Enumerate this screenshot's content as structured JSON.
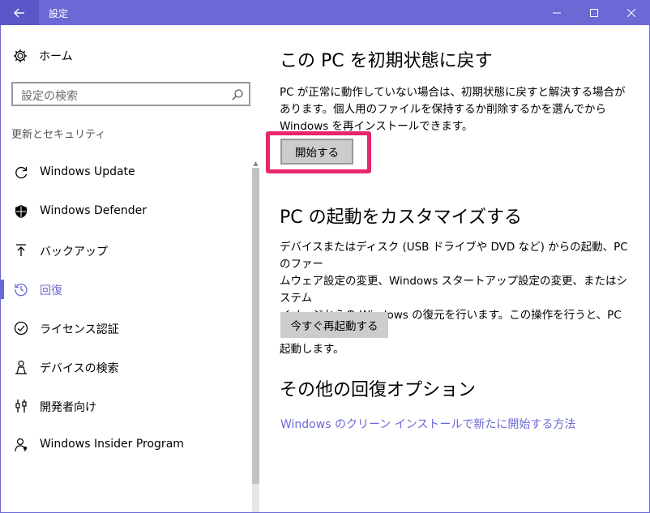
{
  "window": {
    "title": "設定",
    "colors": {
      "accent": "#6b69d6",
      "highlight": "#e6266e"
    }
  },
  "sidebar": {
    "home_label": "ホーム",
    "search_placeholder": "設定の検索",
    "section_label": "更新とセキュリティ",
    "items": [
      {
        "label": "Windows Update",
        "icon": "refresh-icon"
      },
      {
        "label": "Windows Defender",
        "icon": "shield-icon"
      },
      {
        "label": "バックアップ",
        "icon": "upload-icon"
      },
      {
        "label": "回復",
        "icon": "history-icon",
        "active": true
      },
      {
        "label": "ライセンス認証",
        "icon": "check-circle-icon"
      },
      {
        "label": "デバイスの検索",
        "icon": "person-location-icon"
      },
      {
        "label": "開発者向け",
        "icon": "developer-icon"
      },
      {
        "label": "Windows Insider Program",
        "icon": "person-icon"
      }
    ]
  },
  "main": {
    "reset": {
      "heading": "この PC を初期状態に戻す",
      "line1": "PC が正常に動作していない場合は、初期状態に戻すと解決する場合が",
      "line2": "あります。個人用のファイルを保持するか削除するかを選んでから",
      "line3": "Windows を再インストールできます。",
      "button": "開始する"
    },
    "startup": {
      "heading": "PC の起動をカスタマイズする",
      "line1": "デバイスまたはディスク (USB ドライブや DVD など) からの起動、PC のファー",
      "line2": "ムウェア設定の変更、Windows スタートアップ設定の変更、またはシステム",
      "line3": "イメージからの Windows の復元を行います。この操作を行うと、PC が再",
      "line4": "起動します。",
      "button": "今すぐ再起動する"
    },
    "other": {
      "heading": "その他の回復オプション",
      "link": "Windows のクリーン インストールで新たに開始する方法"
    }
  }
}
